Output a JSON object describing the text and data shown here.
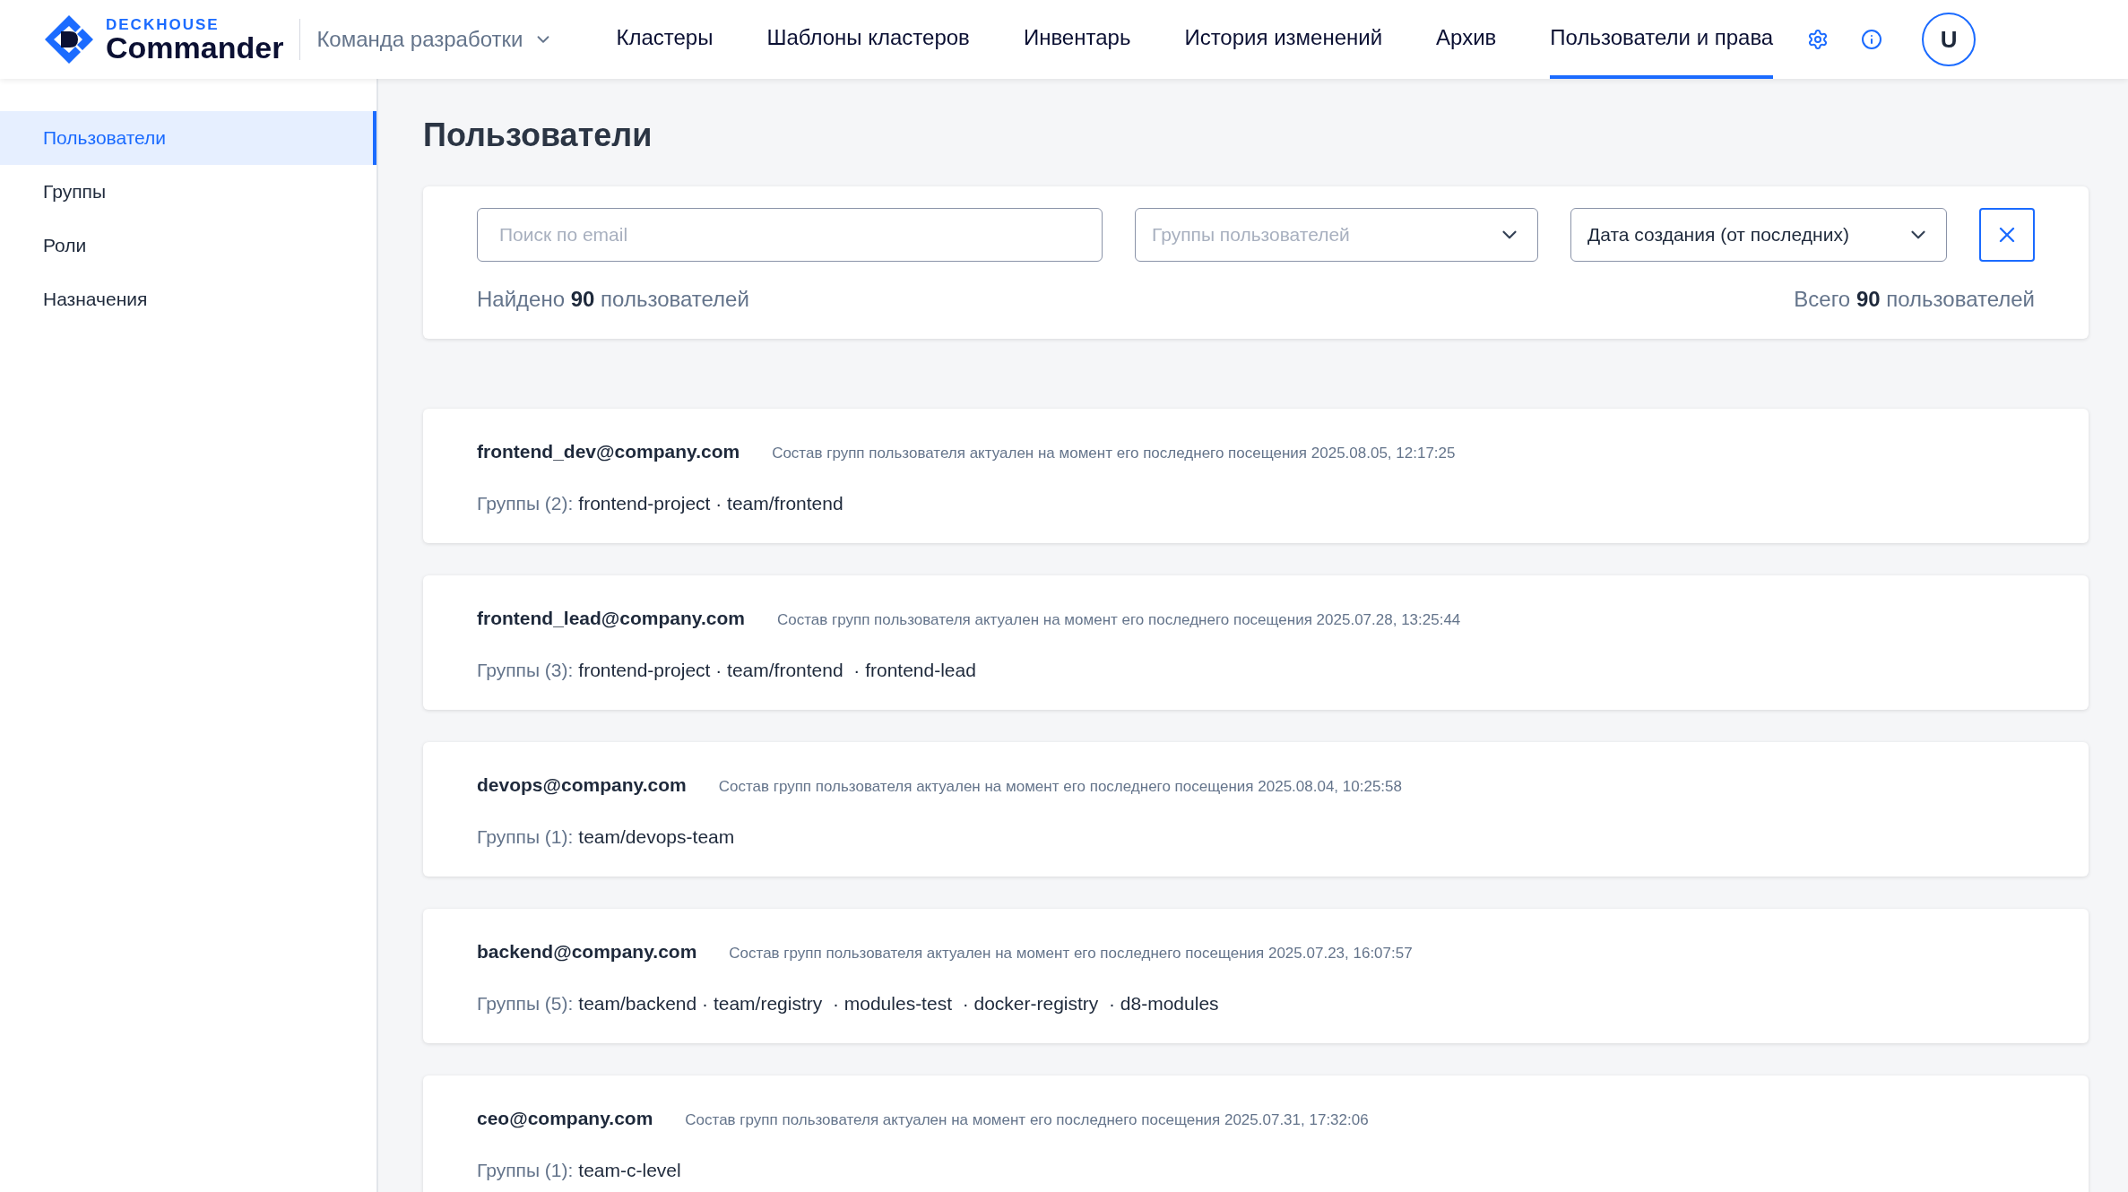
{
  "header": {
    "logo_top": "DECKHOUSE",
    "logo_bottom": "Commander",
    "team": "Команда разработки",
    "nav": [
      {
        "label": "Кластеры",
        "selected": false
      },
      {
        "label": "Шаблоны кластеров",
        "selected": false
      },
      {
        "label": "Инвентарь",
        "selected": false
      },
      {
        "label": "История изменений",
        "selected": false
      },
      {
        "label": "Архив",
        "selected": false
      },
      {
        "label": "Пользователи и права",
        "selected": true
      }
    ],
    "avatar": "U"
  },
  "sidebar": {
    "items": [
      {
        "label": "Пользователи",
        "selected": true
      },
      {
        "label": "Группы",
        "selected": false
      },
      {
        "label": "Роли",
        "selected": false
      },
      {
        "label": "Назначения",
        "selected": false
      }
    ]
  },
  "page_title": "Пользователи",
  "filters": {
    "search": {
      "placeholder": "Поиск по email"
    },
    "groups": {
      "placeholder": "Группы пользователей"
    },
    "sort": {
      "value": "Дата создания (от последних)"
    },
    "found": "Найдено **90** пользователей",
    "total": "Всего **90** пользователей"
  },
  "users": [
    {
      "email": "frontend_dev@company.com",
      "note": "Состав групп пользователя актуален на момент его последнего посещения 2025.08.05, 12:17:25",
      "groups_label": "Группы (2):",
      "groups": "frontend-project · team/frontend"
    },
    {
      "email": "frontend_lead@company.com",
      "note": "Состав групп пользователя актуален на момент его последнего посещения 2025.07.28, 13:25:44",
      "groups_label": "Группы (3):",
      "groups": "frontend-project · team/frontend  · frontend-lead"
    },
    {
      "email": "devops@company.com",
      "note": "Состав групп пользователя актуален на момент его последнего посещения 2025.08.04, 10:25:58",
      "groups_label": "Группы (1):",
      "groups": "team/devops-team"
    },
    {
      "email": "backend@company.com",
      "note": "Состав групп пользователя актуален на момент его последнего посещения 2025.07.23, 16:07:57",
      "groups_label": "Группы (5):",
      "groups": "team/backend · team/registry  · modules-test  · docker-registry  · d8-modules"
    },
    {
      "email": "ceo@company.com",
      "note": "Состав групп пользователя актуален на момент его последнего посещения 2025.07.31, 17:32:06",
      "groups_label": "Группы (1):",
      "groups": "team-c-level"
    }
  ]
}
